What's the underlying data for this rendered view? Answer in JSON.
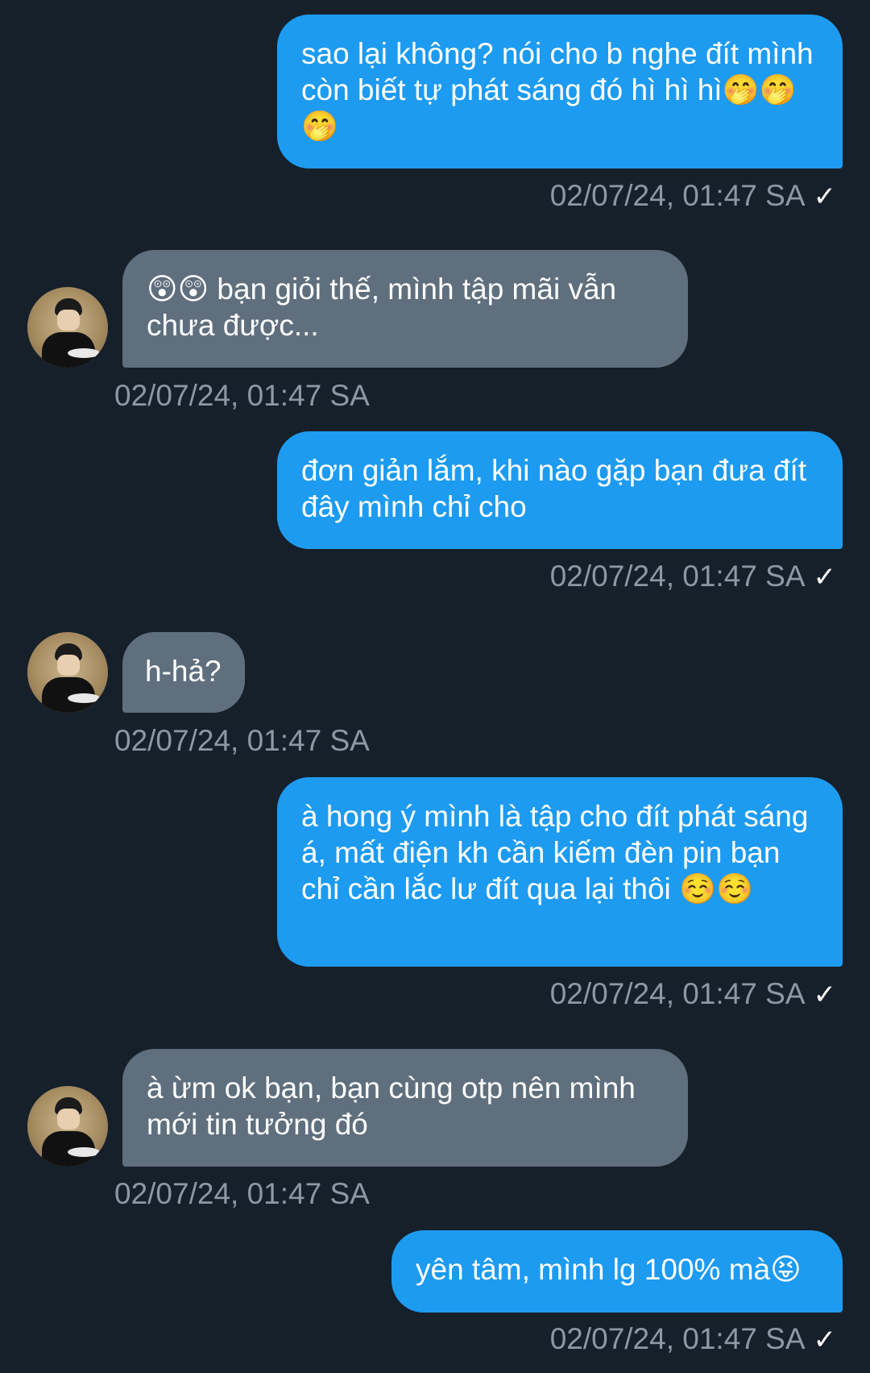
{
  "messages": [
    {
      "dir": "out",
      "text": "sao lại không? nói cho b nghe đít mình còn biết tự phát sáng đó hì hì hì🤭🤭🤭",
      "time": "02/07/24, 01:47 SA",
      "check": "✓"
    },
    {
      "dir": "in",
      "text": "😲😲 bạn giỏi thế, mình tập mãi vẫn chưa được...",
      "time": "02/07/24, 01:47 SA"
    },
    {
      "dir": "out",
      "text": "đơn giản lắm, khi nào gặp bạn đưa đít đây mình chỉ cho",
      "time": "02/07/24, 01:47 SA",
      "check": "✓"
    },
    {
      "dir": "in",
      "text": "h-hả?",
      "time": "02/07/24, 01:47 SA"
    },
    {
      "dir": "out",
      "text": "à hong ý mình là tập cho đít phát sáng á, mất điện kh cần kiếm đèn pin bạn chỉ cần lắc lư đít qua lại thôi ☺️☺️",
      "time": "02/07/24, 01:47 SA",
      "check": "✓"
    },
    {
      "dir": "in",
      "text": "à ừm ok bạn, bạn cùng otp nên mình mới tin tưởng đó",
      "time": "02/07/24, 01:47 SA"
    },
    {
      "dir": "out",
      "text": "yên tâm, mình lg 100% mà😝",
      "time": "02/07/24, 01:47 SA",
      "check": "✓"
    }
  ],
  "colors": {
    "background": "#16202a",
    "outgoing_bubble": "#1d9bf0",
    "incoming_bubble": "#5f6f7e",
    "timestamp": "#8b98a5"
  },
  "icons": {
    "sent_check": "check-icon",
    "contact_avatar": "avatar"
  }
}
